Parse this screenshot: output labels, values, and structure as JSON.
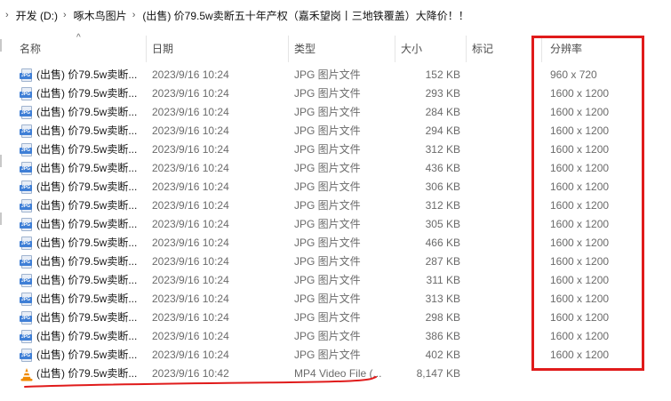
{
  "breadcrumb": {
    "items": [
      "开发 (D:)",
      "啄木鸟图片",
      "(出售) 价79.5w卖断五十年产权（嘉禾望岗丨三地铁覆盖）大降价！！"
    ]
  },
  "columns": {
    "name": "名称",
    "date": "日期",
    "type": "类型",
    "size": "大小",
    "tags": "标记",
    "resolution": "分辨率"
  },
  "files": [
    {
      "name": "(出售) 价79.5w卖断...",
      "date": "2023/9/16 10:24",
      "type": "JPG 图片文件",
      "size": "152 KB",
      "resolution": "960 x 720",
      "icon": "jpg-file-icon"
    },
    {
      "name": "(出售) 价79.5w卖断...",
      "date": "2023/9/16 10:24",
      "type": "JPG 图片文件",
      "size": "293 KB",
      "resolution": "1600 x 1200",
      "icon": "jpg-file-icon"
    },
    {
      "name": "(出售) 价79.5w卖断...",
      "date": "2023/9/16 10:24",
      "type": "JPG 图片文件",
      "size": "284 KB",
      "resolution": "1600 x 1200",
      "icon": "jpg-file-icon"
    },
    {
      "name": "(出售) 价79.5w卖断...",
      "date": "2023/9/16 10:24",
      "type": "JPG 图片文件",
      "size": "294 KB",
      "resolution": "1600 x 1200",
      "icon": "jpg-file-icon"
    },
    {
      "name": "(出售) 价79.5w卖断...",
      "date": "2023/9/16 10:24",
      "type": "JPG 图片文件",
      "size": "312 KB",
      "resolution": "1600 x 1200",
      "icon": "jpg-file-icon"
    },
    {
      "name": "(出售) 价79.5w卖断...",
      "date": "2023/9/16 10:24",
      "type": "JPG 图片文件",
      "size": "436 KB",
      "resolution": "1600 x 1200",
      "icon": "jpg-file-icon"
    },
    {
      "name": "(出售) 价79.5w卖断...",
      "date": "2023/9/16 10:24",
      "type": "JPG 图片文件",
      "size": "306 KB",
      "resolution": "1600 x 1200",
      "icon": "jpg-file-icon"
    },
    {
      "name": "(出售) 价79.5w卖断...",
      "date": "2023/9/16 10:24",
      "type": "JPG 图片文件",
      "size": "312 KB",
      "resolution": "1600 x 1200",
      "icon": "jpg-file-icon"
    },
    {
      "name": "(出售) 价79.5w卖断...",
      "date": "2023/9/16 10:24",
      "type": "JPG 图片文件",
      "size": "305 KB",
      "resolution": "1600 x 1200",
      "icon": "jpg-file-icon"
    },
    {
      "name": "(出售) 价79.5w卖断...",
      "date": "2023/9/16 10:24",
      "type": "JPG 图片文件",
      "size": "466 KB",
      "resolution": "1600 x 1200",
      "icon": "jpg-file-icon"
    },
    {
      "name": "(出售) 价79.5w卖断...",
      "date": "2023/9/16 10:24",
      "type": "JPG 图片文件",
      "size": "287 KB",
      "resolution": "1600 x 1200",
      "icon": "jpg-file-icon"
    },
    {
      "name": "(出售) 价79.5w卖断...",
      "date": "2023/9/16 10:24",
      "type": "JPG 图片文件",
      "size": "311 KB",
      "resolution": "1600 x 1200",
      "icon": "jpg-file-icon"
    },
    {
      "name": "(出售) 价79.5w卖断...",
      "date": "2023/9/16 10:24",
      "type": "JPG 图片文件",
      "size": "313 KB",
      "resolution": "1600 x 1200",
      "icon": "jpg-file-icon"
    },
    {
      "name": "(出售) 价79.5w卖断...",
      "date": "2023/9/16 10:24",
      "type": "JPG 图片文件",
      "size": "298 KB",
      "resolution": "1600 x 1200",
      "icon": "jpg-file-icon"
    },
    {
      "name": "(出售) 价79.5w卖断...",
      "date": "2023/9/16 10:24",
      "type": "JPG 图片文件",
      "size": "386 KB",
      "resolution": "1600 x 1200",
      "icon": "jpg-file-icon"
    },
    {
      "name": "(出售) 价79.5w卖断...",
      "date": "2023/9/16 10:24",
      "type": "JPG 图片文件",
      "size": "402 KB",
      "resolution": "1600 x 1200",
      "icon": "jpg-file-icon"
    },
    {
      "name": "(出售) 价79.5w卖断...",
      "date": "2023/9/16 10:42",
      "type": "MP4 Video File (...",
      "size": "8,147 KB",
      "resolution": "",
      "icon": "vlc-video-icon"
    }
  ],
  "colors": {
    "highlight_box": "#e01b1b",
    "jpg_badge": "#3f7fd6",
    "vlc_orange": "#f08a00"
  }
}
